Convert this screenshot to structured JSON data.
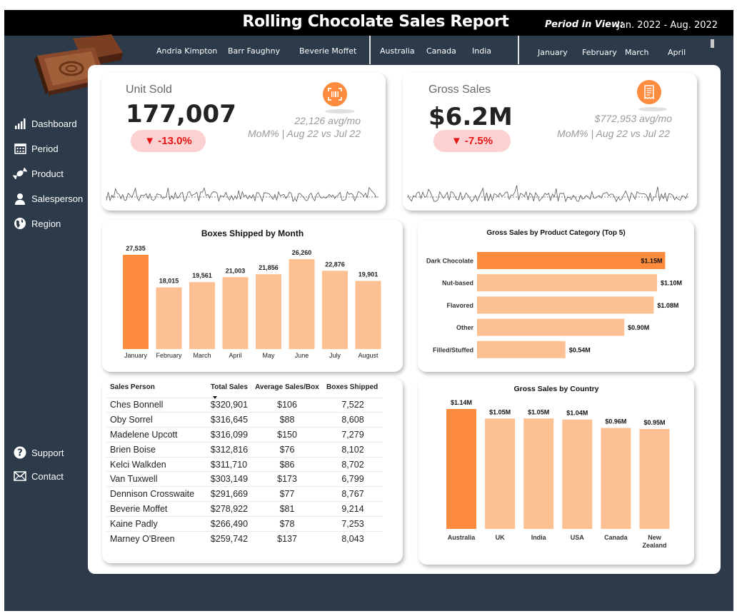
{
  "header": {
    "title": "Rolling Chocolate Sales Report",
    "period_label": "Period in View:",
    "period_value": "Jan. 2022 - Aug. 2022"
  },
  "slicers": {
    "salespeople": [
      "Andria Kimpton",
      "Barr Faughny",
      "Beverie Moffet"
    ],
    "countries": [
      "Australia",
      "Canada",
      "India"
    ],
    "months": [
      "January",
      "February",
      "March",
      "April"
    ]
  },
  "nav": {
    "top": [
      {
        "label": "Dashboard",
        "icon": "bar-chart-icon"
      },
      {
        "label": "Period",
        "icon": "calendar-icon"
      },
      {
        "label": "Product",
        "icon": "candy-icon"
      },
      {
        "label": "Salesperson",
        "icon": "person-icon"
      },
      {
        "label": "Region",
        "icon": "globe-icon"
      }
    ],
    "bottom": [
      {
        "label": "Support",
        "icon": "help-icon"
      },
      {
        "label": "Contact",
        "icon": "mail-icon"
      }
    ]
  },
  "kpis": {
    "units": {
      "label": "Unit Sold",
      "value": "177,007",
      "change": "▼ -13.0%",
      "avg": "22,126 avg/mo",
      "note": "MoM% | Aug 22 vs Jul 22",
      "icon": "barcode-icon"
    },
    "gross": {
      "label": "Gross Sales",
      "value": "$6.2M",
      "change": "▼ -7.5%",
      "avg": "$772,953 avg/mo",
      "note": "MoM% | Aug 22 vs Jul 22",
      "icon": "receipt-icon"
    }
  },
  "colors": {
    "accent": "#fd8c3e",
    "light": "#fdc092",
    "bg": "#2c3a4a",
    "negative": "#e51616",
    "negative_bg": "#fbd1d1"
  },
  "chart_data": [
    {
      "type": "bar",
      "title": "Boxes Shipped by Month",
      "categories": [
        "January",
        "February",
        "March",
        "April",
        "May",
        "June",
        "July",
        "August"
      ],
      "values": [
        27535,
        18015,
        19561,
        21003,
        21856,
        26260,
        22876,
        19901
      ],
      "value_labels": [
        "27,535",
        "18,015",
        "19,561",
        "21,003",
        "21,856",
        "26,260",
        "22,876",
        "19,901"
      ],
      "highlight_index": 0
    },
    {
      "type": "bar",
      "orientation": "horizontal",
      "title": "Gross Sales by Product Category (Top 5)",
      "categories": [
        "Dark Chocolate",
        "Nut-based",
        "Flavored",
        "Other",
        "Filled/Stuffed"
      ],
      "values": [
        1.15,
        1.1,
        1.08,
        0.9,
        0.54
      ],
      "value_labels": [
        "$1.15M",
        "$1.10M",
        "$1.08M",
        "$0.90M",
        "$0.54M"
      ],
      "highlight_index": 0
    },
    {
      "type": "bar",
      "title": "Gross Sales by Country",
      "categories": [
        "Australia",
        "UK",
        "India",
        "USA",
        "Canada",
        "New Zealand"
      ],
      "values": [
        1.14,
        1.05,
        1.05,
        1.04,
        0.96,
        0.95
      ],
      "value_labels": [
        "$1.14M",
        "$1.05M",
        "$1.05M",
        "$1.04M",
        "$0.96M",
        "$0.95M"
      ],
      "highlight_index": 0
    },
    {
      "type": "table",
      "columns": [
        "Sales Person",
        "Total Sales",
        "Average Sales/Box",
        "Boxes Shipped"
      ],
      "sort_column": 1,
      "rows": [
        [
          "Ches Bonnell",
          "$320,901",
          "$106",
          "7,522"
        ],
        [
          "Oby Sorrel",
          "$316,645",
          "$88",
          "8,608"
        ],
        [
          "Madelene Upcott",
          "$316,099",
          "$150",
          "7,279"
        ],
        [
          "Brien Boise",
          "$312,816",
          "$76",
          "8,102"
        ],
        [
          "Kelci Walkden",
          "$311,710",
          "$86",
          "8,702"
        ],
        [
          "Van Tuxwell",
          "$303,149",
          "$173",
          "6,799"
        ],
        [
          "Dennison Crosswaite",
          "$291,669",
          "$77",
          "8,767"
        ],
        [
          "Beverie Moffet",
          "$278,922",
          "$81",
          "9,214"
        ],
        [
          "Kaine Padly",
          "$266,490",
          "$78",
          "7,253"
        ],
        [
          "Marney O'Breen",
          "$259,742",
          "$137",
          "8,043"
        ]
      ]
    }
  ]
}
